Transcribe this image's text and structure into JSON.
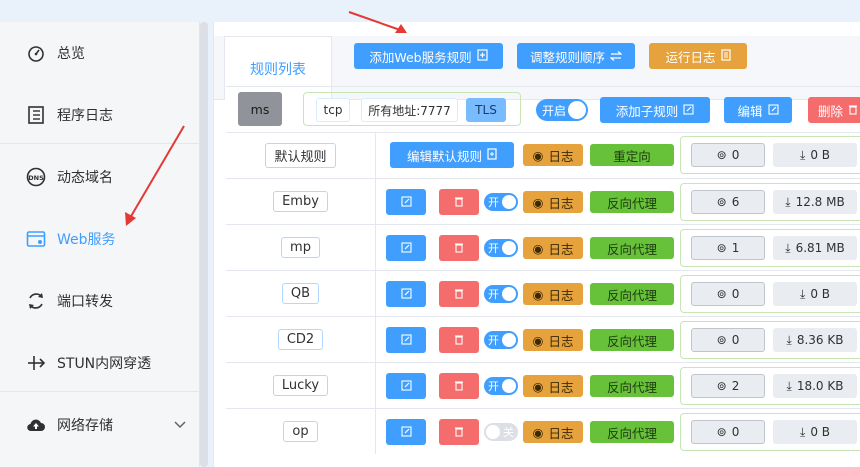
{
  "sidebar": {
    "items": [
      {
        "label": "总览",
        "icon": "dashboard-icon"
      },
      {
        "label": "程序日志",
        "icon": "log-icon"
      },
      {
        "label": "动态域名",
        "icon": "dns-icon"
      },
      {
        "label": "Web服务",
        "icon": "web-service-icon"
      },
      {
        "label": "端口转发",
        "icon": "port-forward-icon"
      },
      {
        "label": "STUN内网穿透",
        "icon": "stun-icon"
      },
      {
        "label": "网络存储",
        "icon": "cloud-storage-icon"
      }
    ],
    "active": "Web服务"
  },
  "toolbar": {
    "tab_label": "规则列表",
    "add_web_rule": "添加Web服务规则",
    "reorder_rules": "调整规则顺序",
    "run_log": "运行日志"
  },
  "rule": {
    "mode": "ms",
    "protocol": "tcp",
    "address": "所有地址:7777",
    "tls": "TLS",
    "switch_label": "开启",
    "add_subrule": "添加子规则",
    "edit": "编辑",
    "delete": "删除"
  },
  "default_rule": {
    "name": "默认规则",
    "edit_label": "编辑默认规则",
    "log_label": "日志",
    "action": "重定向",
    "connections": "0",
    "traffic": "0 B"
  },
  "subrules": [
    {
      "name": "Emby",
      "enabled": true,
      "switch_text": "开",
      "log": "日志",
      "action": "反向代理",
      "connections": "6",
      "traffic": "12.8 MB"
    },
    {
      "name": "mp",
      "enabled": true,
      "switch_text": "开",
      "log": "日志",
      "action": "反向代理",
      "connections": "1",
      "traffic": "6.81 MB"
    },
    {
      "name": "QB",
      "enabled": true,
      "switch_text": "开",
      "log": "日志",
      "action": "反向代理",
      "connections": "0",
      "traffic": "0 B"
    },
    {
      "name": "CD2",
      "enabled": true,
      "switch_text": "开",
      "log": "日志",
      "action": "反向代理",
      "connections": "0",
      "traffic": "8.36 KB"
    },
    {
      "name": "Lucky",
      "enabled": true,
      "switch_text": "开",
      "log": "日志",
      "action": "反向代理",
      "connections": "2",
      "traffic": "18.0 KB"
    },
    {
      "name": "op",
      "enabled": false,
      "switch_text": "关",
      "log": "日志",
      "action": "反向代理",
      "connections": "0",
      "traffic": "0 B"
    }
  ],
  "colors": {
    "primary": "#409eff",
    "warning": "#e6a23c",
    "danger": "#f56c6c",
    "success": "#67c23a",
    "annotation_arrow": "#e53935"
  }
}
